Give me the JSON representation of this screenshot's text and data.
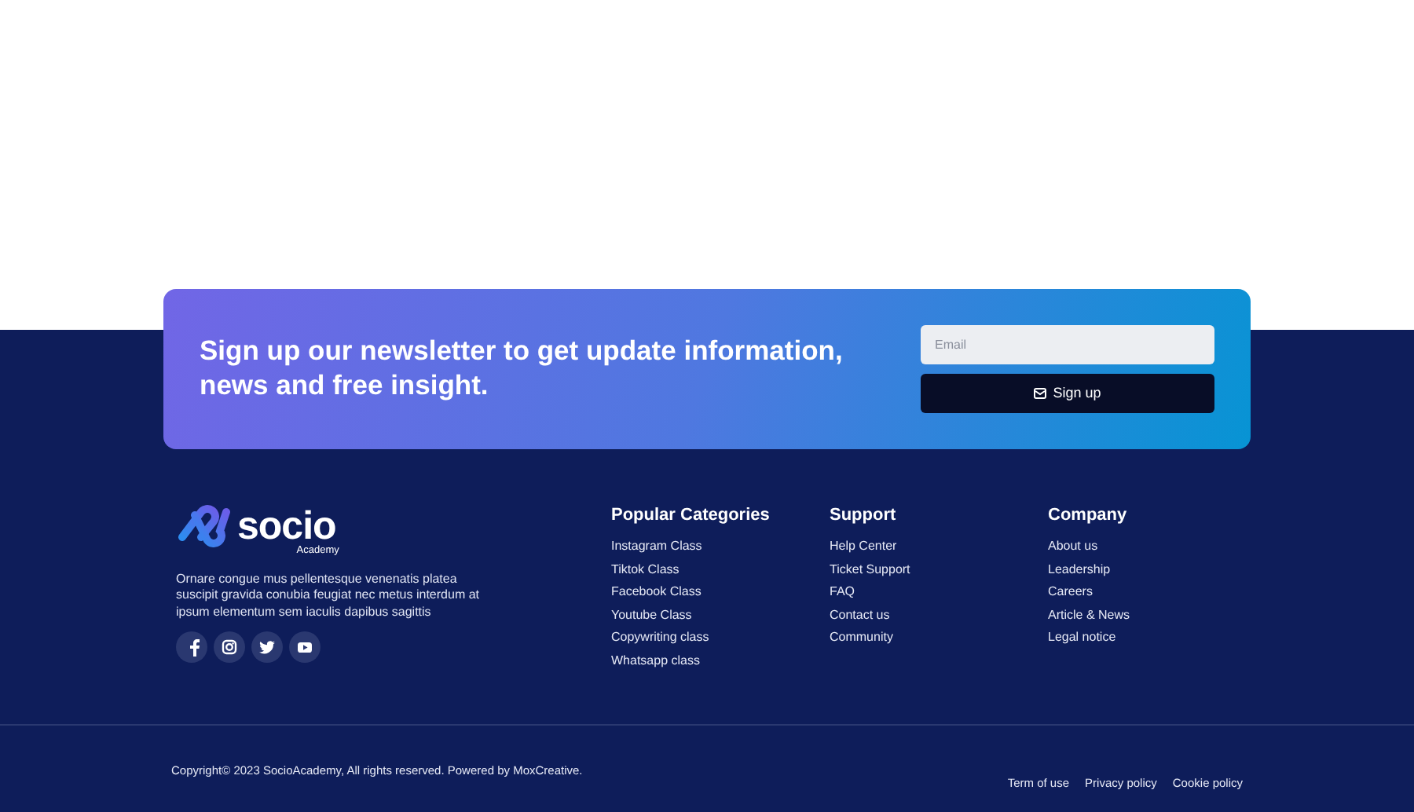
{
  "newsletter": {
    "heading": "Sign up our newsletter to get update information, news and free insight.",
    "email": {
      "placeholder": "Email"
    },
    "button": "Sign up"
  },
  "brand": {
    "name": "socio",
    "subtitle": "Academy",
    "description": "Ornare congue mus pellentesque venenatis platea suscipit gravida conubia feugiat nec metus interdum at ipsum elementum sem iaculis dapibus sagittis"
  },
  "social": [
    {
      "kind": "facebook"
    },
    {
      "kind": "instagram"
    },
    {
      "kind": "twitter"
    },
    {
      "kind": "youtube"
    }
  ],
  "columns": [
    {
      "title": "Popular Categories",
      "links": [
        "Instagram Class",
        "Tiktok Class",
        "Facebook Class",
        "Youtube Class",
        "Copywriting class",
        "Whatsapp class"
      ]
    },
    {
      "title": "Support",
      "links": [
        "Help Center",
        "Ticket Support",
        "FAQ",
        "Contact us",
        "Community"
      ]
    },
    {
      "title": "Company",
      "links": [
        "About us",
        "Leadership",
        "Careers",
        "Article & News",
        "Legal notice"
      ]
    }
  ],
  "bottom": {
    "copyright": "Copyright© 2023 SocioAcademy, All rights reserved. Powered by MoxCreative.",
    "links": [
      "Term of use",
      "Privacy policy",
      "Cookie policy"
    ]
  }
}
